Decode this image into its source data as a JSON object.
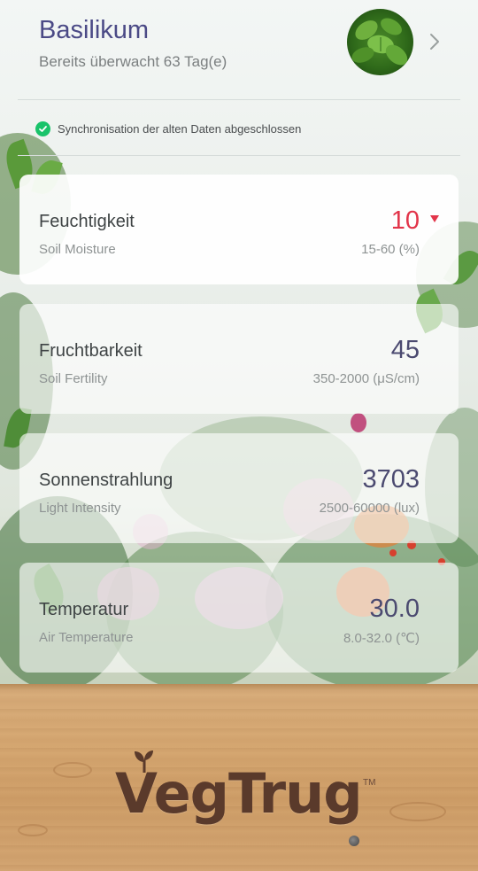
{
  "header": {
    "plant_name": "Basilikum",
    "monitored_text": "Bereits überwacht 63 Tag(e)"
  },
  "sync": {
    "status_text": "Synchronisation der alten Daten abgeschlossen",
    "status_color": "#19c36a"
  },
  "metrics": [
    {
      "title": "Feuchtigkeit",
      "subtitle": "Soil Moisture",
      "value": "10",
      "range": "15-60 (%)",
      "alert": true,
      "alert_color": "#e2354a"
    },
    {
      "title": "Fruchtbarkeit",
      "subtitle": "Soil Fertility",
      "value": "45",
      "range": "350-2000 (μS/cm)",
      "alert": false
    },
    {
      "title": "Sonnenstrahlung",
      "subtitle": "Light Intensity",
      "value": "3703",
      "range": "2500-60000 (lux)",
      "alert": false
    },
    {
      "title": "Temperatur",
      "subtitle": "Air Temperature",
      "value": "30.0",
      "range": "8.0-32.0 (℃)",
      "alert": false
    }
  ],
  "branding": {
    "logo_text": "VegTrug",
    "trademark": "TM"
  },
  "colors": {
    "title_color": "#4b4a86",
    "alert": "#e2354a",
    "ok": "#19c36a"
  },
  "icons": [
    "chevron-right-icon",
    "check-circle-icon",
    "alert-down-icon",
    "sprout-icon"
  ]
}
